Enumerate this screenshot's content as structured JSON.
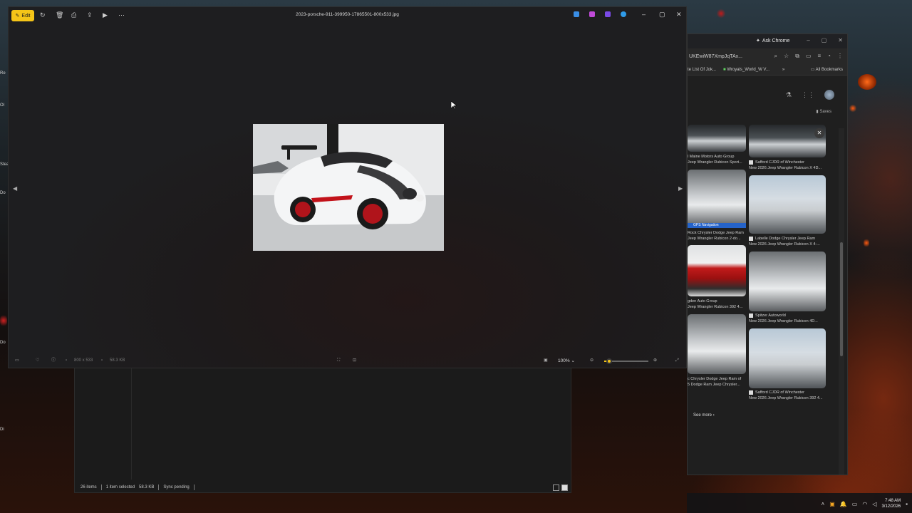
{
  "photos": {
    "edit_label": "Edit",
    "file_title": "2023-porsche-911-399950-17865501-800x533.jpg",
    "dimensions": "800 x 533",
    "file_size": "58.3 KB",
    "zoom": "100%",
    "zoom_level_fraction": 0.12
  },
  "explorer": {
    "items_count": "26 items",
    "selection": "1 item selected",
    "selection_size": "58.3 KB",
    "sync_status": "Sync pending"
  },
  "chrome": {
    "ask_chrome": "Ask Chrome",
    "address_fragment": "UKEwiW87XmpJqTAx...",
    "bookmarks": [
      "te List Of Jok...",
      "Wroyals_World_W V..."
    ],
    "all_bookmarks": "All Bookmarks",
    "saves": "Saves",
    "results": [
      {
        "source": "l Maine Motors Auto Group",
        "title": "Jeep Wrangler Rubicon Sport..."
      },
      {
        "source": "Safford CJDR of Winchester",
        "title": "New 2026 Jeep Wrangler Rubicon X 4D..."
      },
      {
        "badge": "GPS Navigation",
        "source": "Rock Chrysler Dodge Jeep Ram",
        "title": "Jeep Wrangler Rubicon 2-do..."
      },
      {
        "source": "Labelle Dodge Chrysler Jeep Ram",
        "title": "New 2026 Jeep Wrangler Rubicon X 4-..."
      },
      {
        "source": "gden Auto Group",
        "title": "Jeep Wrangler Rubicon 392 4..."
      },
      {
        "source": "Spitzer Autoworld",
        "title": "New 2026 Jeep Wrangler Rubicon 4D..."
      },
      {
        "source": "c Chrysler Dodge Jeep Ram of",
        "title": "5 Dodge Ram Jeep Chrysler..."
      },
      {
        "source": "Safford CJDR of Winchester",
        "title": "New 2026 Jeep Wrangler Rubicon 392 4..."
      }
    ],
    "see_more": "See more"
  },
  "taskbar": {
    "time": "7:48 AM",
    "date": "3/12/2026"
  },
  "colors": {
    "accent": "#f5c518",
    "viewer_bg": "#1e1e20"
  }
}
